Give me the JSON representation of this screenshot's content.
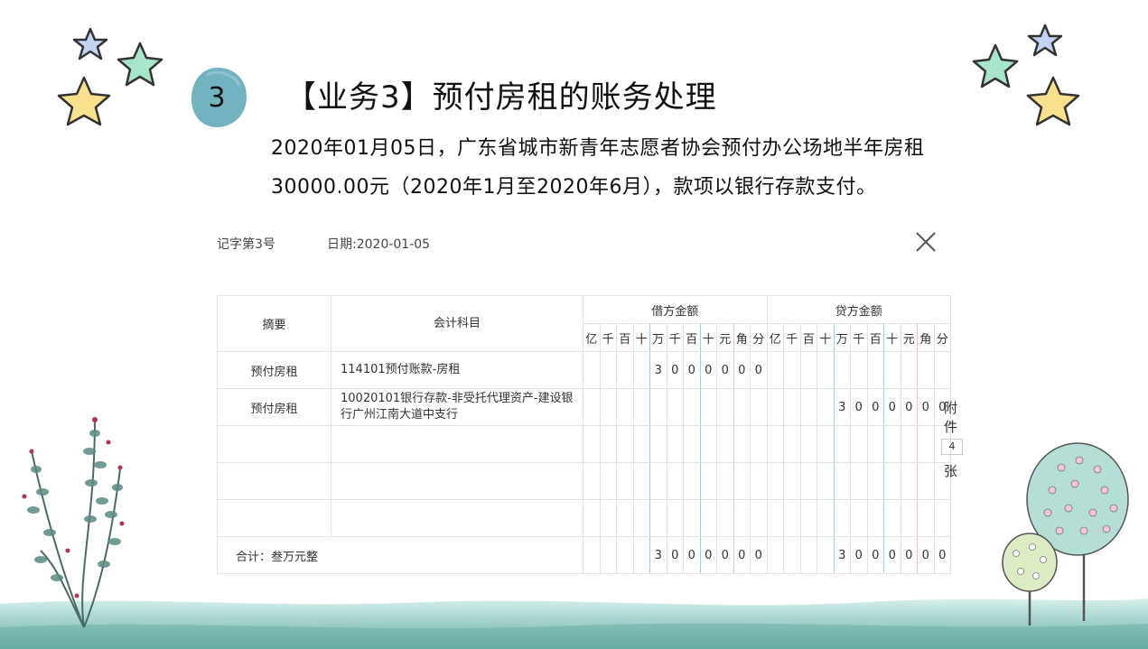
{
  "slide": {
    "badge_number": "3",
    "title": "【业务3】预付房租的账务处理",
    "description_line1": "2020年01月05日，广东省城市新青年志愿者协会预付办公场地半年房租",
    "description_line2": "30000.00元（2020年1月至2020年6月），款项以银行存款支付。"
  },
  "voucher": {
    "voucher_no": "记字第3号",
    "date_label": "日期:2020-01-05",
    "headers": {
      "summary": "摘要",
      "account": "会计科目",
      "debit": "借方金额",
      "credit": "贷方金额",
      "units": [
        "亿",
        "千",
        "百",
        "十",
        "万",
        "千",
        "百",
        "十",
        "元",
        "角",
        "分"
      ]
    },
    "rows": [
      {
        "summary": "预付房租",
        "account": "114101预付账款-房租",
        "debit": [
          "",
          "",
          "",
          "",
          "3",
          "0",
          "0",
          "0",
          "0",
          "0",
          "0"
        ],
        "credit": [
          "",
          "",
          "",
          "",
          "",
          "",
          "",
          "",
          "",
          "",
          ""
        ]
      },
      {
        "summary": "预付房租",
        "account": "10020101银行存款-非受托代理资产-建设银行广州江南大道中支行",
        "debit": [
          "",
          "",
          "",
          "",
          "",
          "",
          "",
          "",
          "",
          "",
          ""
        ],
        "credit": [
          "",
          "",
          "",
          "",
          "3",
          "0",
          "0",
          "0",
          "0",
          "0",
          "0"
        ]
      },
      {
        "summary": "",
        "account": "",
        "debit": [
          "",
          "",
          "",
          "",
          "",
          "",
          "",
          "",
          "",
          "",
          ""
        ],
        "credit": [
          "",
          "",
          "",
          "",
          "",
          "",
          "",
          "",
          "",
          "",
          ""
        ]
      },
      {
        "summary": "",
        "account": "",
        "debit": [
          "",
          "",
          "",
          "",
          "",
          "",
          "",
          "",
          "",
          "",
          ""
        ],
        "credit": [
          "",
          "",
          "",
          "",
          "",
          "",
          "",
          "",
          "",
          "",
          ""
        ]
      },
      {
        "summary": "",
        "account": "",
        "debit": [
          "",
          "",
          "",
          "",
          "",
          "",
          "",
          "",
          "",
          "",
          ""
        ],
        "credit": [
          "",
          "",
          "",
          "",
          "",
          "",
          "",
          "",
          "",
          "",
          ""
        ]
      }
    ],
    "total": {
      "label": "合计：叁万元整",
      "debit": [
        "",
        "",
        "",
        "",
        "3",
        "0",
        "0",
        "0",
        "0",
        "0",
        "0"
      ],
      "credit": [
        "",
        "",
        "",
        "",
        "3",
        "0",
        "0",
        "0",
        "0",
        "0",
        "0"
      ]
    },
    "attachment": {
      "label_top1": "附",
      "label_top2": "件",
      "count": "4",
      "label_bottom": "张"
    }
  },
  "colors": {
    "badge": "#5aa6b4",
    "star_yellow": "#f8e08e",
    "star_mint": "#a8e6cc",
    "star_blue": "#c5d3f2"
  }
}
